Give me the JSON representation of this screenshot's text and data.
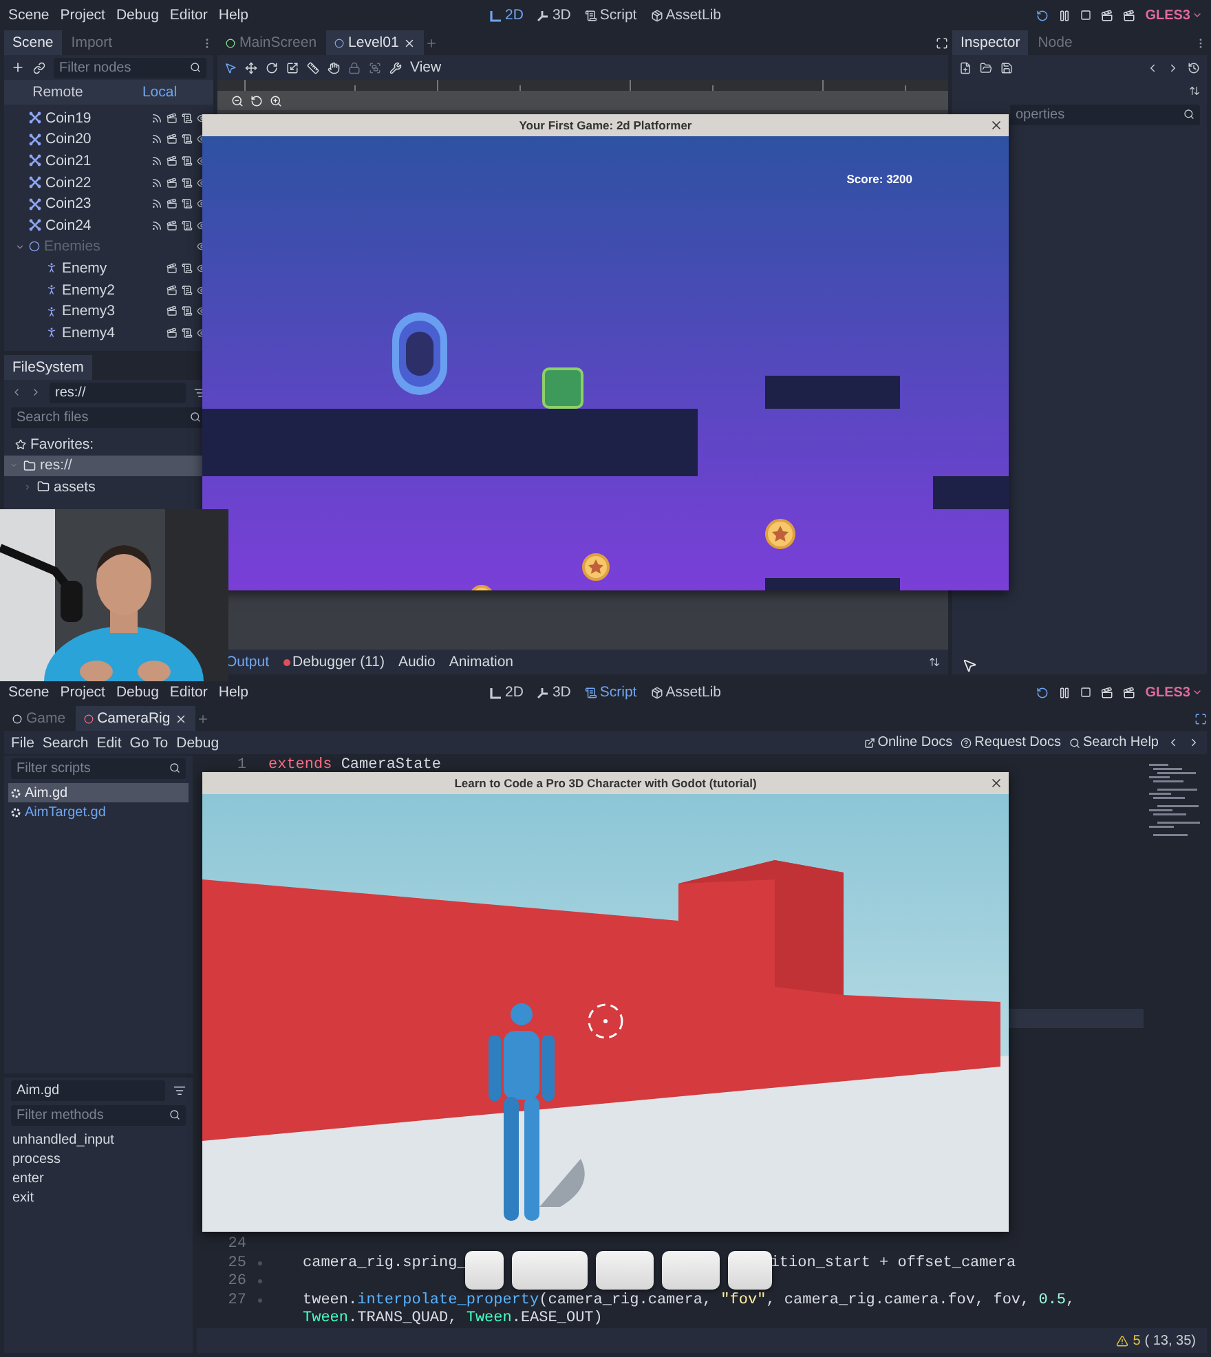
{
  "top_editor": {
    "menu": [
      "Scene",
      "Project",
      "Debug",
      "Editor",
      "Help"
    ],
    "workspaces": [
      {
        "label": "2D",
        "kind": "canvas",
        "selected": true
      },
      {
        "label": "3D",
        "kind": "spatial",
        "selected": false
      },
      {
        "label": "Script",
        "kind": "script",
        "selected": false
      },
      {
        "label": "AssetLib",
        "kind": "assetlib",
        "selected": false
      }
    ],
    "renderer": "GLES3",
    "scene_dock": {
      "tabs": [
        {
          "label": "Scene",
          "selected": true
        },
        {
          "label": "Import",
          "selected": false
        }
      ],
      "filter_placeholder": "Filter nodes",
      "modes": [
        {
          "label": "Remote",
          "selected": false
        },
        {
          "label": "Local",
          "selected": true
        }
      ],
      "nodes": [
        {
          "name": "Coin19",
          "kind": "coin",
          "disabled": false
        },
        {
          "name": "Coin20",
          "kind": "coin",
          "disabled": false
        },
        {
          "name": "Coin21",
          "kind": "coin",
          "disabled": false
        },
        {
          "name": "Coin22",
          "kind": "coin",
          "disabled": false
        },
        {
          "name": "Coin23",
          "kind": "coin",
          "disabled": false
        },
        {
          "name": "Coin24",
          "kind": "coin",
          "disabled": false
        },
        {
          "name": "Enemies",
          "kind": "group",
          "disabled": true,
          "expanded": true,
          "children": [
            {
              "name": "Enemy",
              "kind": "enemy",
              "disabled": false
            },
            {
              "name": "Enemy2",
              "kind": "enemy",
              "disabled": false
            },
            {
              "name": "Enemy3",
              "kind": "enemy",
              "disabled": false
            },
            {
              "name": "Enemy4",
              "kind": "enemy",
              "disabled": false
            }
          ]
        }
      ]
    },
    "filesystem": {
      "title": "FileSystem",
      "path": "res://",
      "search_placeholder": "Search files",
      "favorites": "Favorites:",
      "folders": [
        {
          "label": "res://",
          "selected": true,
          "expanded": true,
          "children": [
            {
              "label": "assets",
              "selected": false,
              "expanded": false
            }
          ]
        }
      ]
    },
    "scene_tabs": [
      {
        "label": "MainScreen",
        "selected": false
      },
      {
        "label": "Level01",
        "selected": true
      }
    ],
    "view_menu": "View",
    "bottom_tabs": [
      {
        "label": "Output",
        "selected": true,
        "alert": false
      },
      {
        "label": "Debugger (11)",
        "selected": false,
        "alert": true
      },
      {
        "label": "Audio",
        "selected": false,
        "alert": false
      },
      {
        "label": "Animation",
        "selected": false,
        "alert": false
      }
    ],
    "inspector": {
      "tabs": [
        {
          "label": "Inspector",
          "selected": true
        },
        {
          "label": "Node",
          "selected": false
        }
      ],
      "filter_placeholder": "operties"
    },
    "game_window": {
      "title": "Your First Game: 2d Platformer",
      "score": "Score: 3200"
    }
  },
  "bottom_editor": {
    "menu": [
      "Scene",
      "Project",
      "Debug",
      "Editor",
      "Help"
    ],
    "workspaces": [
      {
        "label": "2D",
        "kind": "canvas",
        "selected": false
      },
      {
        "label": "3D",
        "kind": "spatial",
        "selected": false
      },
      {
        "label": "Script",
        "kind": "script",
        "selected": true
      },
      {
        "label": "AssetLib",
        "kind": "assetlib",
        "selected": false
      }
    ],
    "renderer": "GLES3",
    "scene_tabs": [
      {
        "label": "Game",
        "selected": false
      },
      {
        "label": "CameraRig",
        "selected": true
      }
    ],
    "script_menu": [
      "File",
      "Search",
      "Edit",
      "Go To",
      "Debug"
    ],
    "help_links": [
      {
        "label": "Online Docs",
        "kind": "docs"
      },
      {
        "label": "Request Docs",
        "kind": "request"
      },
      {
        "label": "Search Help",
        "kind": "search"
      }
    ],
    "scripts": {
      "filter_placeholder": "Filter scripts",
      "items": [
        {
          "label": "Aim.gd",
          "selected": true
        },
        {
          "label": "AimTarget.gd",
          "selected": false
        }
      ]
    },
    "methods": {
      "current": "Aim.gd",
      "filter_placeholder": "Filter methods",
      "items": [
        "unhandled_input",
        "process",
        "enter",
        "exit"
      ]
    },
    "code_top": [
      {
        "number": "1",
        "indented": false,
        "segments": [
          {
            "text": "extends",
            "kind": "keyword"
          },
          {
            "text": " CameraState",
            "kind": "plain"
          }
        ]
      }
    ],
    "code_bottom": [
      {
        "number": "24",
        "indented": false
      },
      {
        "number": "25",
        "indented": true,
        "segments": [
          {
            "text": "camera_rig.spring_",
            "kind": "plain"
          },
          {
            "kind": "covered"
          },
          {
            "text": "ition_start + offset_camera",
            "kind": "plain"
          }
        ]
      },
      {
        "number": "26",
        "indented": true
      },
      {
        "number": "27",
        "indented": true,
        "segments": [
          {
            "text": "tween.",
            "kind": "plain"
          },
          {
            "text": "interpolate_property",
            "kind": "function"
          },
          {
            "text": "(camera_rig.camera, ",
            "kind": "plain"
          },
          {
            "text": "\"fov\"",
            "kind": "string"
          },
          {
            "text": ", camera_rig.camera.fov, fov, ",
            "kind": "plain"
          },
          {
            "text": "0.5",
            "kind": "number"
          },
          {
            "text": ",",
            "kind": "plain"
          }
        ]
      },
      {
        "indented": true,
        "segments": [
          {
            "text": "Tween",
            "kind": "type"
          },
          {
            "text": ".TRANS_QUAD, ",
            "kind": "plain"
          },
          {
            "text": "Tween",
            "kind": "type"
          },
          {
            "text": ".EASE_OUT)",
            "kind": "plain"
          }
        ]
      }
    ],
    "status": {
      "warnings": "5",
      "cursor": "( 13, 35)"
    },
    "game_window": {
      "title": "Learn to Code a Pro 3D Character with Godot (tutorial)"
    }
  }
}
